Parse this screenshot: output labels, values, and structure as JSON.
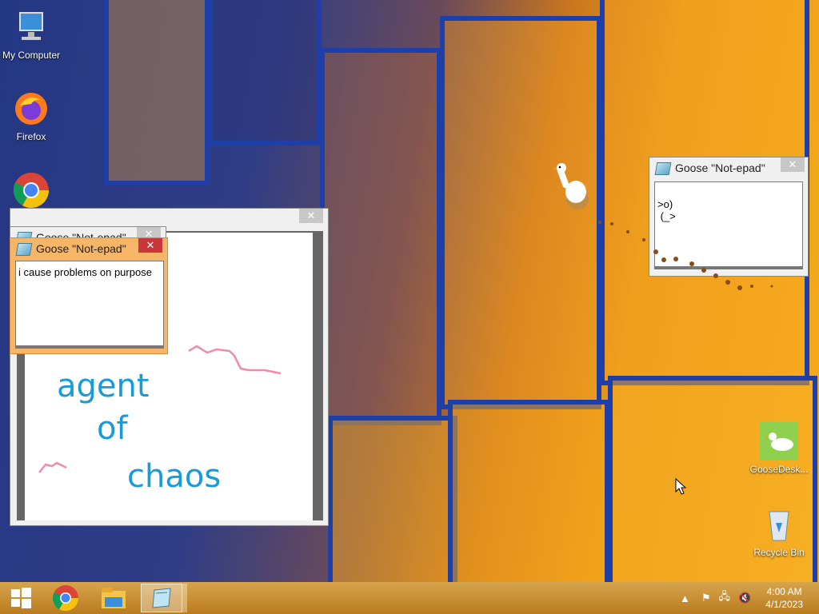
{
  "desktop": {
    "icons": [
      {
        "label": "My Computer",
        "icon": "computer-icon"
      },
      {
        "label": "Firefox",
        "icon": "firefox-icon"
      },
      {
        "label": "",
        "icon": "chrome-icon"
      },
      {
        "label": "GooseDesk...",
        "icon": "goose-icon"
      },
      {
        "label": "Recycle Bin",
        "icon": "recycle-bin-icon"
      }
    ]
  },
  "windows": {
    "notepad_back": {
      "title": "Goose \"Not-epad\""
    },
    "notepad_front": {
      "title": "Goose \"Not-epad\"",
      "text": "i cause problems on purpose"
    },
    "notepad_right": {
      "title": "Goose \"Not-epad\"",
      "text": ">o)\n (_>"
    },
    "paint": {
      "drawing_words": [
        "agent",
        "of",
        "chaos"
      ]
    }
  },
  "taskbar": {
    "buttons": [
      {
        "name": "start",
        "icon": "windows-logo-icon"
      },
      {
        "name": "chrome",
        "icon": "chrome-icon"
      },
      {
        "name": "file-explorer",
        "icon": "folder-icon"
      },
      {
        "name": "notepad",
        "icon": "notepad-icon"
      }
    ],
    "time": "4:00 AM",
    "date": "4/1/2023"
  },
  "colors": {
    "taskbar": "#b97b1e",
    "accent_close": "#c9373a",
    "ink": "#1a9ad6",
    "pink": "#f08aa8"
  }
}
